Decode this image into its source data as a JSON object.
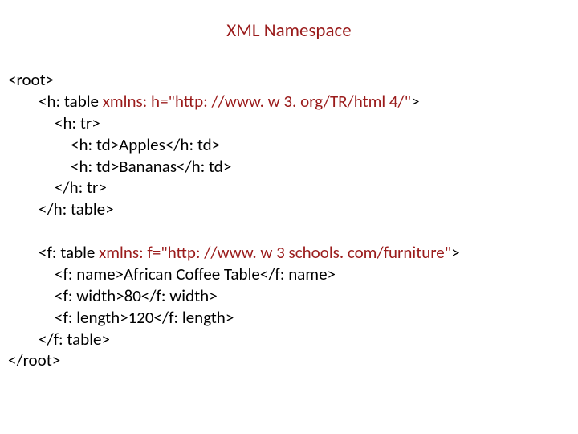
{
  "title": "XML Namespace",
  "code": {
    "l1": "<root>",
    "l2a": "<h: table ",
    "l2b": "xmlns: h=\"http: //www. w 3. org/TR/html 4/\"",
    "l2c": ">",
    "l3": "<h: tr>",
    "l4": "<h: td>Apples</h: td>",
    "l5": "<h: td>Bananas</h: td>",
    "l6": "</h: tr>",
    "l7": "</h: table>",
    "l8": "",
    "l9a": "<f: table ",
    "l9b": "xmlns: f=\"http: //www. w 3 schools. com/furniture\"",
    "l9c": ">",
    "l10": "<f: name>African Coffee Table</f: name>",
    "l11": "<f: width>80</f: width>",
    "l12": "<f: length>120</f: length>",
    "l13": "</f: table>",
    "l14": "</root>"
  }
}
